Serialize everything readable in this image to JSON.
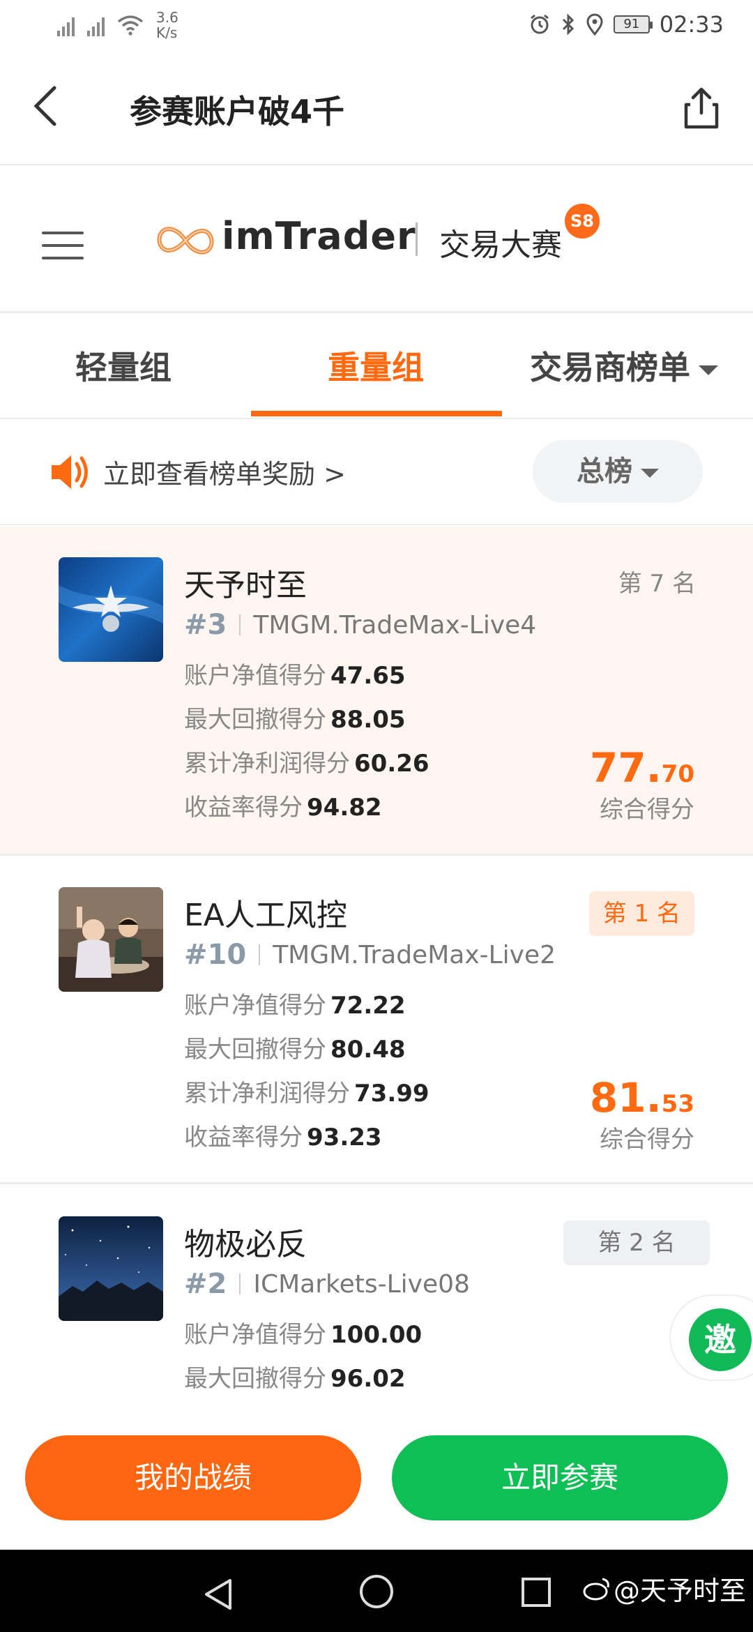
{
  "status_bar": {
    "net_speed": "3.6",
    "net_unit": "K/s",
    "battery": "91",
    "time": "02:33"
  },
  "header": {
    "title": "参赛账户破4千"
  },
  "brand": {
    "name": "imTrader",
    "subtitle": "交易大赛",
    "season_badge": "S8",
    "accent_color": "#ff6a10"
  },
  "tabs": [
    {
      "label": "轻量组",
      "active": false
    },
    {
      "label": "重量组",
      "active": true
    },
    {
      "label": "交易商榜单",
      "active": false
    }
  ],
  "reward_banner": {
    "text": "立即查看榜单奖励 >",
    "board_select": "总榜"
  },
  "entries": [
    {
      "name": "天予时至",
      "rank": "第 7 名",
      "id_num": "#3",
      "server": "TMGM.TradeMax-Live4",
      "metrics": [
        {
          "label": "账户净值得分",
          "value": "47.65"
        },
        {
          "label": "最大回撤得分",
          "value": "88.05"
        },
        {
          "label": "累计净利润得分",
          "value": "60.26"
        },
        {
          "label": "收益率得分",
          "value": "94.82"
        }
      ],
      "total_int": "77.",
      "total_dec": "70",
      "total_label": "综合得分"
    },
    {
      "name": "EA人工风控",
      "rank": "第 1 名",
      "id_num": "#10",
      "server": "TMGM.TradeMax-Live2",
      "metrics": [
        {
          "label": "账户净值得分",
          "value": "72.22"
        },
        {
          "label": "最大回撤得分",
          "value": "80.48"
        },
        {
          "label": "累计净利润得分",
          "value": "73.99"
        },
        {
          "label": "收益率得分",
          "value": "93.23"
        }
      ],
      "total_int": "81.",
      "total_dec": "53",
      "total_label": "综合得分"
    },
    {
      "name": "物极必反",
      "rank": "第 2 名",
      "id_num": "#2",
      "server": "ICMarkets-Live08",
      "metrics": [
        {
          "label": "账户净值得分",
          "value": "100.00"
        },
        {
          "label": "最大回撤得分",
          "value": "96.02"
        }
      ]
    }
  ],
  "invite": {
    "label": "邀"
  },
  "buttons": {
    "my_record": "我的战绩",
    "join_now": "立即参赛"
  },
  "watermark": "@天予时至"
}
